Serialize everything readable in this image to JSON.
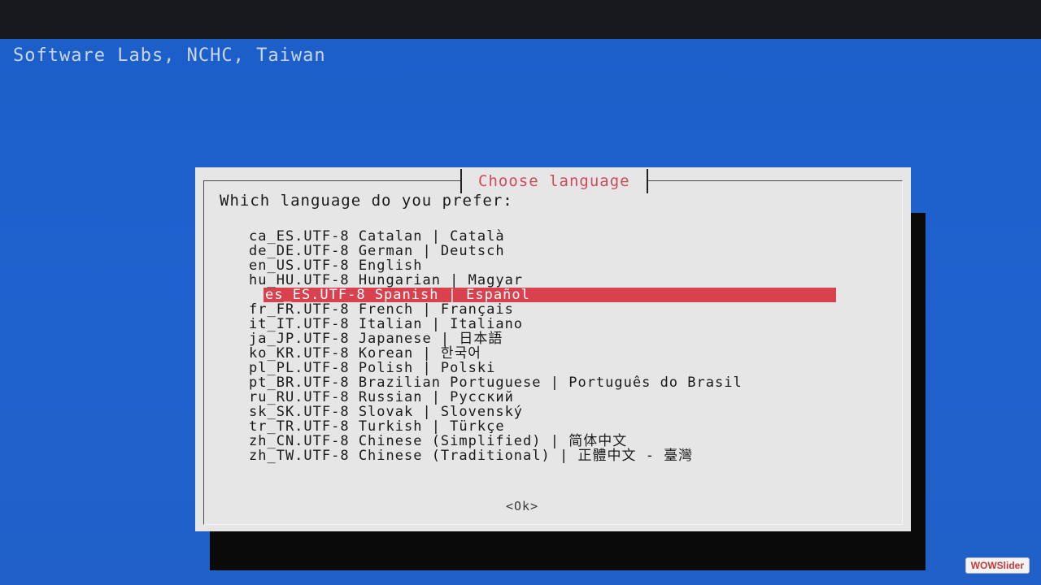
{
  "header": {
    "text": "Software Labs, NCHC, Taiwan"
  },
  "dialog": {
    "title": "Choose language",
    "question": "Which language do you prefer:",
    "items": [
      {
        "label": "ca_ES.UTF-8 Catalan | Català"
      },
      {
        "label": "de_DE.UTF-8 German | Deutsch"
      },
      {
        "label": "en_US.UTF-8 English"
      },
      {
        "label": "hu_HU.UTF-8 Hungarian | Magyar"
      },
      {
        "label": "es_ES.UTF-8 Spanish | Español",
        "selected": true
      },
      {
        "label": "fr_FR.UTF-8 French | Français"
      },
      {
        "label": "it_IT.UTF-8 Italian | Italiano"
      },
      {
        "label": "ja_JP.UTF-8 Japanese | 日本語"
      },
      {
        "label": "ko_KR.UTF-8 Korean | 한국어"
      },
      {
        "label": "pl_PL.UTF-8 Polish | Polski"
      },
      {
        "label": "pt_BR.UTF-8 Brazilian Portuguese | Português do Brasil"
      },
      {
        "label": "ru_RU.UTF-8 Russian | Русский"
      },
      {
        "label": "sk_SK.UTF-8 Slovak | Slovenský"
      },
      {
        "label": "tr_TR.UTF-8 Turkish | Türkçe"
      },
      {
        "label": "zh_CN.UTF-8 Chinese (Simplified) | 简体中文"
      },
      {
        "label": "zh_TW.UTF-8 Chinese (Traditional) | 正體中文 - 臺灣"
      }
    ],
    "ok_label": "<Ok>"
  },
  "watermark": {
    "text": "WOWSlider"
  },
  "colors": {
    "background": "#1f62cf",
    "dialog": "#e6e6e6",
    "title": "#cf4a5c",
    "selection": "#d9414f"
  }
}
